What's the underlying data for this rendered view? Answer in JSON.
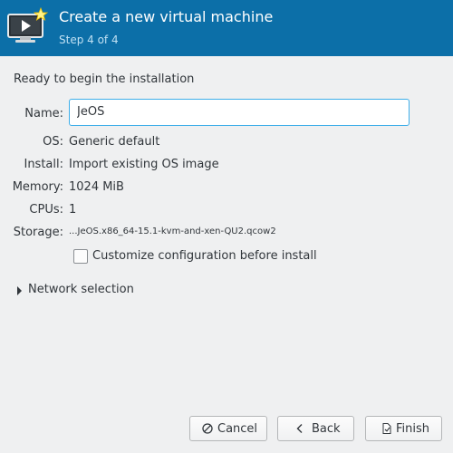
{
  "header": {
    "title": "Create a new virtual machine",
    "subtitle": "Step 4 of 4",
    "icon": "virtual-machine-new-icon"
  },
  "main": {
    "intro": "Ready to begin the installation",
    "name": {
      "label": "Name:",
      "value": "JeOS"
    },
    "details": [
      {
        "label": "OS:",
        "value": "Generic default"
      },
      {
        "label": "Install:",
        "value": "Import existing OS image"
      },
      {
        "label": "Memory:",
        "value": "1024 MiB"
      },
      {
        "label": "CPUs:",
        "value": "1"
      },
      {
        "label": "Storage:",
        "value": "...JeOS.x86_64-15.1-kvm-and-xen-QU2.qcow2"
      }
    ],
    "customize": {
      "label": "Customize configuration before install",
      "checked": false
    },
    "network": {
      "label": "Network selection",
      "expanded": false
    }
  },
  "buttons": {
    "cancel": "Cancel",
    "back": "Back",
    "finish": "Finish"
  },
  "colors": {
    "header_bg": "#0c6fa8",
    "accent": "#3daee9",
    "window_bg": "#eff0f1"
  }
}
